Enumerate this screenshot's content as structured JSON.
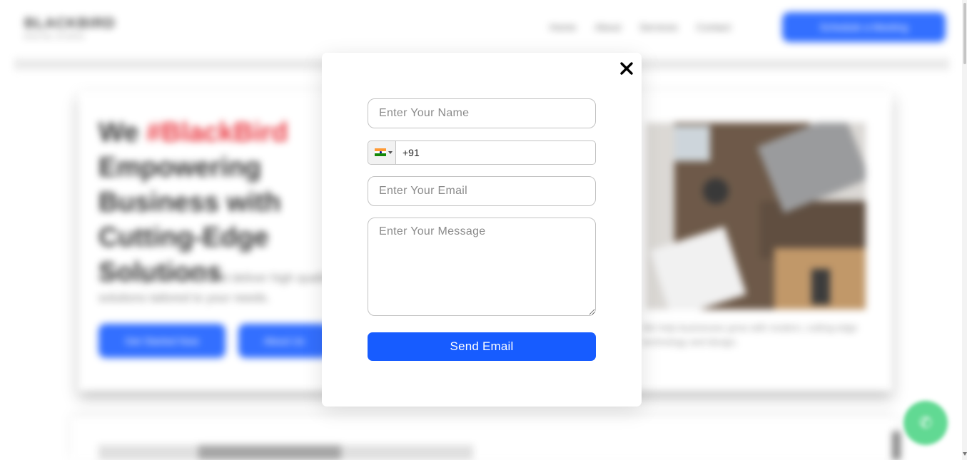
{
  "background": {
    "logo": "BLACKBIRD",
    "logo_sub": "DIGITAL STUDIO",
    "nav": [
      "Home",
      "About",
      "Services",
      "Contact"
    ],
    "cta_label": "Schedule a Meeting",
    "headline_prefix": "We",
    "headline_accent": "#BlackBird",
    "headline_rest": "Empowering Business with Cutting-Edge Solutions",
    "subtitle": "We design, develop and deliver high quality solutions tailored to your needs.",
    "button_primary": "Get Started Now",
    "button_secondary": "About Us",
    "image_caption": "We help businesses grow with modern, cutting-edge technology and design."
  },
  "modal": {
    "close_label": "×",
    "name_placeholder": "Enter Your Name",
    "phone_code": "+91",
    "email_placeholder": "Enter Your Email",
    "message_placeholder": "Enter Your Message",
    "send_label": "Send Email"
  },
  "colors": {
    "accent": "#175cff",
    "highlight": "#e8202a",
    "whatsapp": "#4cd484"
  },
  "icons": {
    "close": "close-icon",
    "flag": "india-flag-icon",
    "caret": "chevron-down-icon",
    "whatsapp": "whatsapp-icon"
  }
}
